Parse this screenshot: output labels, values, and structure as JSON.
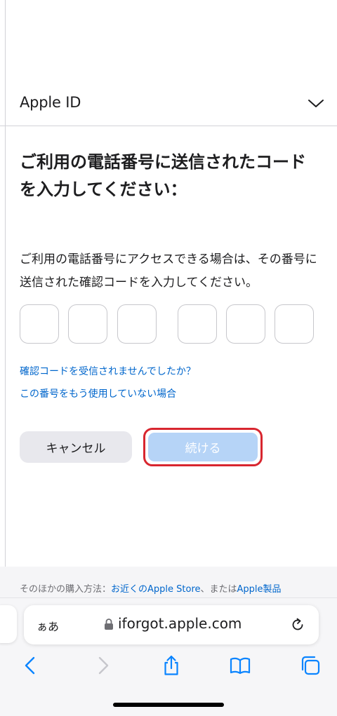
{
  "header": {
    "title": "Apple ID"
  },
  "main": {
    "title": "ご利用の電話番号に送信されたコードを入力してください：",
    "description": "ご利用の電話番号にアクセスできる場合は、その番号に送信された確認コードを入力してください。",
    "code_digits": [
      "",
      "",
      "",
      "",
      "",
      ""
    ],
    "links": {
      "not_received": "確認コードを受信されませんでしたか？",
      "no_longer_use": "この番号をもう使用していない場合"
    },
    "buttons": {
      "cancel": "キャンセル",
      "continue": "続ける"
    }
  },
  "footer": {
    "prefix": "そのほかの購入方法：",
    "link1": "お近くのApple Store",
    "middle": "、または",
    "link2": "Apple製品"
  },
  "browser": {
    "aa_label": "ぁあ",
    "url": "iforgot.apple.com",
    "icons": [
      "back-icon",
      "forward-icon",
      "share-icon",
      "bookmarks-icon",
      "tabs-icon",
      "lock-icon",
      "reload-icon"
    ]
  },
  "colors": {
    "link": "#0066cc",
    "continue_disabled": "#b6d4f7",
    "highlight": "#d8262f",
    "cancel_bg": "#e8e8ed"
  }
}
